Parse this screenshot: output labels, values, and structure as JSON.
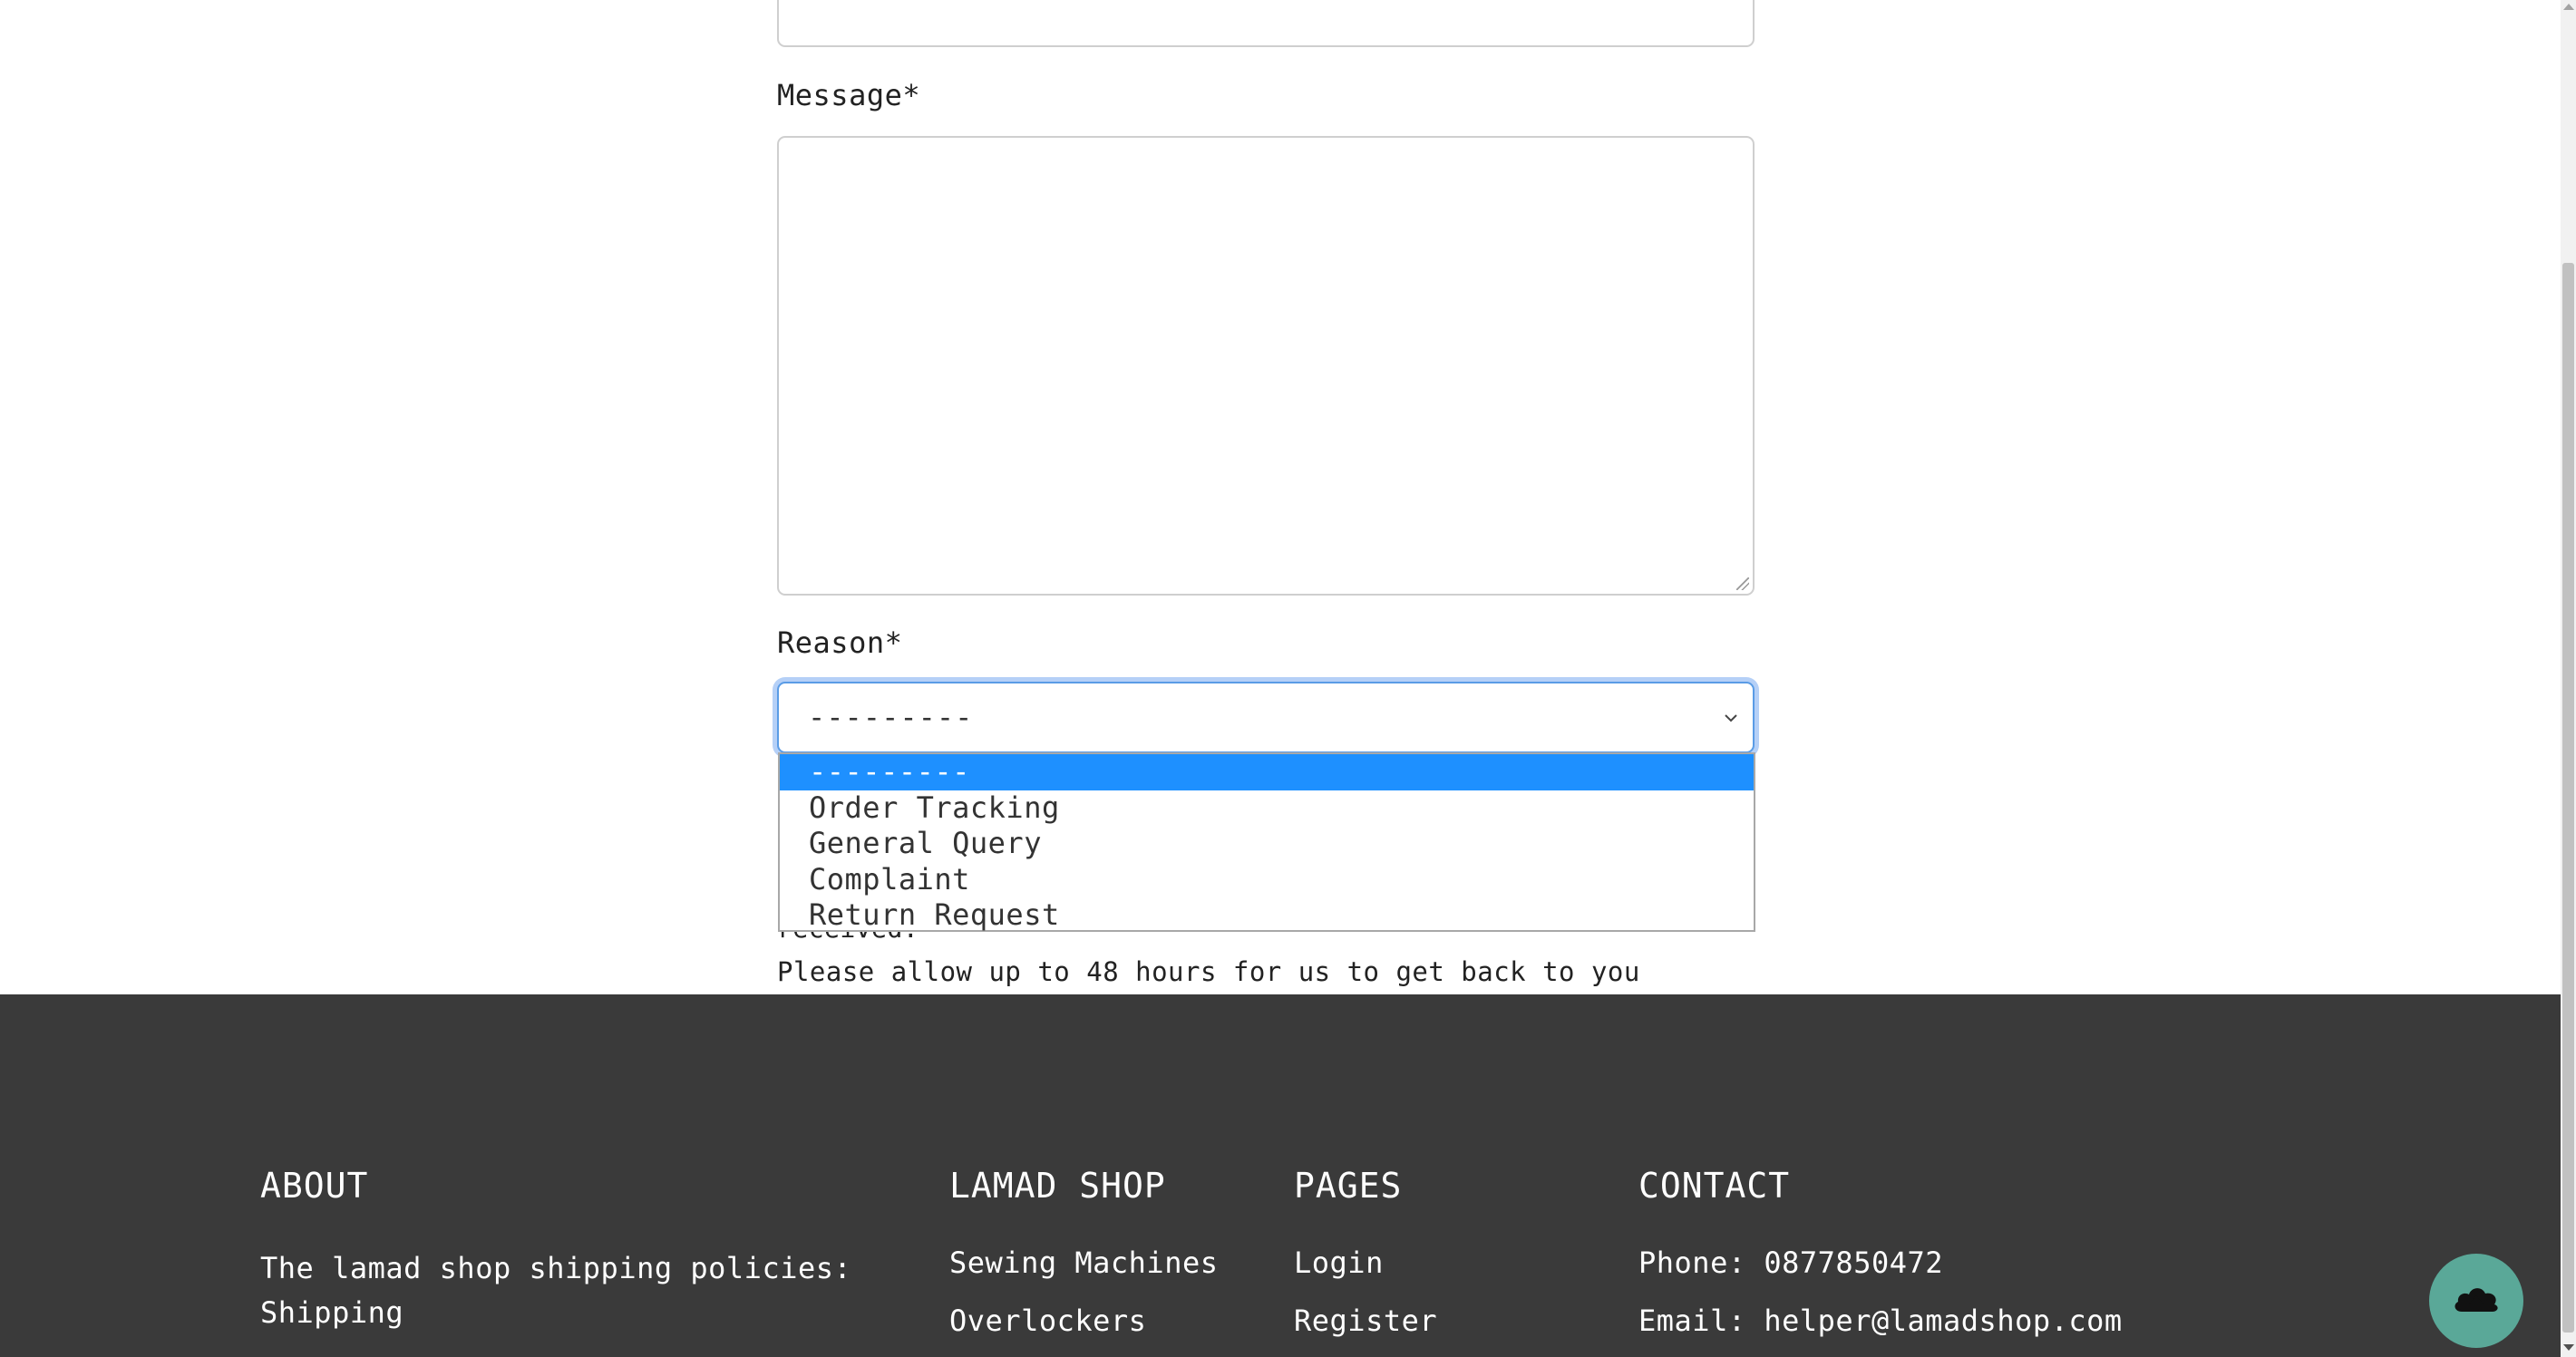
{
  "form": {
    "message_label": "Message*",
    "reason_label": "Reason*",
    "reason_selected": "---------",
    "reason_options": [
      "---------",
      "Order Tracking",
      "General Query",
      "Complaint",
      "Return Request"
    ],
    "received_fragment": "received.",
    "allow_text": "Please allow up to 48 hours for us to get back to you"
  },
  "footer": {
    "about": {
      "heading": "ABOUT",
      "text": "The lamad shop shipping policies: Shipping"
    },
    "shop": {
      "heading": "LAMAD SHOP",
      "links": [
        "Sewing Machines",
        "Overlockers"
      ]
    },
    "pages": {
      "heading": "PAGES",
      "links": [
        "Login",
        "Register"
      ]
    },
    "contact": {
      "heading": "CONTACT",
      "phone": "Phone: 0877850472",
      "email": "Email: helper@lamadshop.com"
    }
  },
  "colors": {
    "footer_bg": "#3a3a3a",
    "selected_option": "#1e90ff",
    "back_to_top": "#5aa898",
    "focus_ring": "#5a9ce6"
  },
  "icons": {
    "select_chevron": "chevron-down-icon",
    "back_to_top": "cloud-up-icon"
  }
}
